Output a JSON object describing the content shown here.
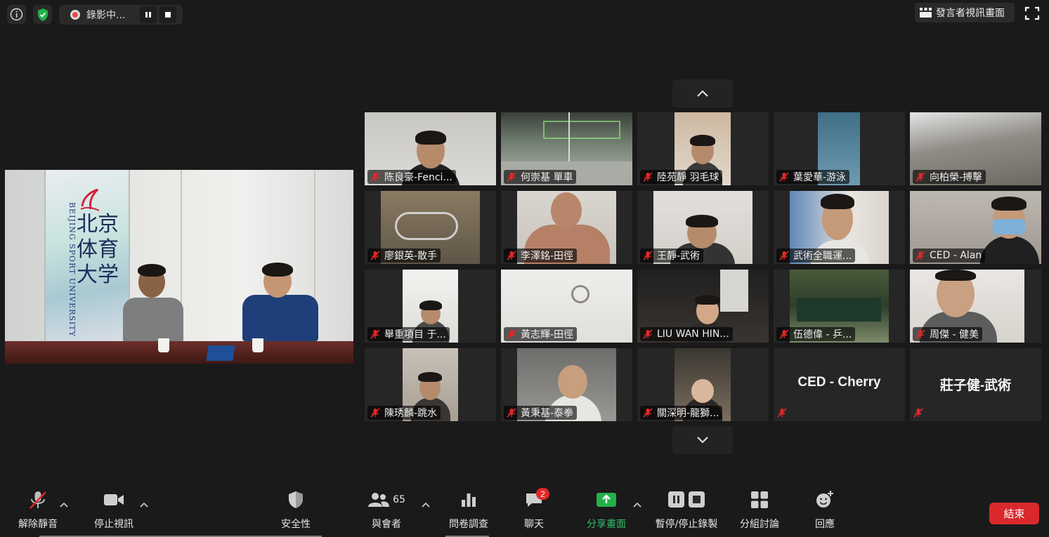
{
  "top": {
    "recording_label": "錄影中...",
    "speaker_view_label": "發言者視訊畫面"
  },
  "main_video": {
    "banner_university_en": "BEIJING SPORT UNIVERSITY",
    "banner_university_cn": "北京体育大学"
  },
  "gallery": {
    "tiles": [
      {
        "name": "陈良豪-Fenci..."
      },
      {
        "name": "何崇基 單車"
      },
      {
        "name": "陸苑靜 羽毛球"
      },
      {
        "name": "葉愛華-游泳"
      },
      {
        "name": "向柏榮-搏擊"
      },
      {
        "name": "廖銀英-散手"
      },
      {
        "name": "李澤銘-田徑"
      },
      {
        "name": "王靜-武術"
      },
      {
        "name": "武術全職運..."
      },
      {
        "name": "CED - Alan"
      },
      {
        "name": "舉重項目 于..."
      },
      {
        "name": "黃志輝-田徑"
      },
      {
        "name": "LIU WAN HIN..."
      },
      {
        "name": "伍德偉 - 乒..."
      },
      {
        "name": "周傑 - 健美"
      },
      {
        "name": "陳琇麟-跳水"
      },
      {
        "name": "黃秉基-泰拳"
      },
      {
        "name": "關深明-龍獅..."
      },
      {
        "big_name": "CED - Cherry"
      },
      {
        "big_name": "莊子健-武術"
      }
    ]
  },
  "toolbar": {
    "unmute_label": "解除靜音",
    "stop_video_label": "停止視訊",
    "security_label": "安全性",
    "participants_label": "與會者",
    "participants_count": "65",
    "polls_label": "問卷調查",
    "chat_label": "聊天",
    "chat_badge": "2",
    "share_label": "分享畫面",
    "record_label": "暫停/停止錄製",
    "breakout_label": "分組討論",
    "reactions_label": "回應",
    "end_label": "結束"
  },
  "colors": {
    "background": "#1a1a1a",
    "share_green": "#2ec167",
    "end_red": "#d9292c",
    "mute_red": "#e02828"
  },
  "icons": [
    "info-icon",
    "shield-icon",
    "record-dot-icon",
    "pause-icon",
    "stop-icon",
    "speaker-view-icon",
    "fullscreen-icon",
    "chevron-up-icon",
    "chevron-down-icon",
    "mic-muted-icon",
    "camera-icon",
    "security-shield-icon",
    "participants-icon",
    "polls-icon",
    "chat-icon",
    "share-screen-icon",
    "record-pause-stop-icon",
    "breakout-rooms-icon",
    "reactions-icon"
  ]
}
